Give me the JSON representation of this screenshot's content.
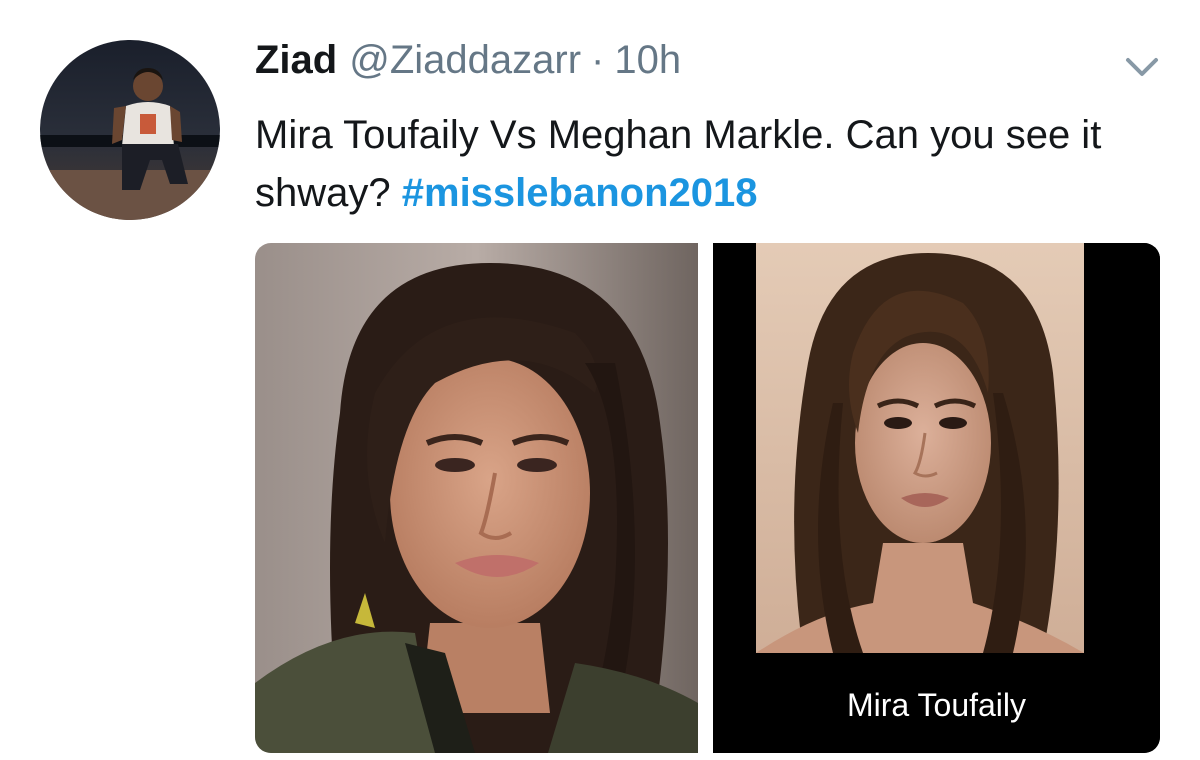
{
  "tweet": {
    "display_name": "Ziad",
    "handle": "@Ziaddazarr",
    "separator": "·",
    "time": "10h",
    "text_main": "Mira Toufaily Vs Meghan Markle. Can you see it shway?",
    "hashtag": "#misslebanon2018",
    "more_icon": "chevron-down-icon",
    "avatar_icon": "profile-photo",
    "media": {
      "left_image": "photo-meghan-markle",
      "right_image": "photo-mira-toufaily",
      "right_caption": "Mira Toufaily"
    }
  },
  "colors": {
    "text": "#14171a",
    "secondary": "#657786",
    "link": "#1b95e0",
    "caption_bg": "#000000"
  }
}
